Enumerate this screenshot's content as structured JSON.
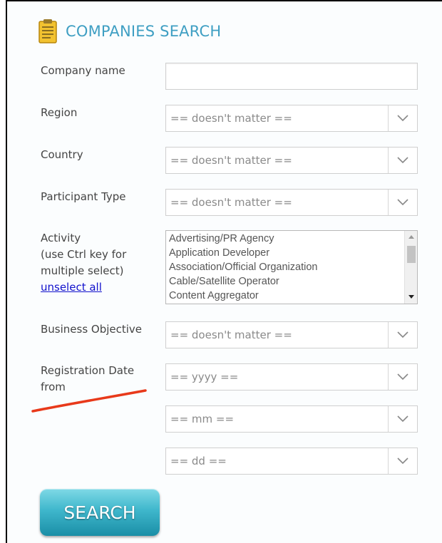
{
  "header": {
    "title": "COMPANIES SEARCH",
    "icon": "clipboard-icon"
  },
  "form": {
    "company_name": {
      "label": "Company name",
      "value": "",
      "placeholder": ""
    },
    "region": {
      "label": "Region",
      "selected": "== doesn't matter =="
    },
    "country": {
      "label": "Country",
      "selected": "== doesn't matter =="
    },
    "participant_type": {
      "label": "Participant Type",
      "selected": "== doesn't matter =="
    },
    "activity": {
      "label_line1": "Activity",
      "label_line2": "(use Ctrl key for",
      "label_line3": "multiple select)",
      "unselect_label": "unselect all",
      "options": [
        "Advertising/PR Agency",
        "Application Developer",
        "Association/Official Organization",
        "Cable/Satellite Operator",
        "Content Aggregator"
      ]
    },
    "business_objective": {
      "label": "Business Objective",
      "selected": "== doesn't matter =="
    },
    "registration_date": {
      "label_line1": "Registration Date",
      "label_line2": "from",
      "year": "== yyyy ==",
      "month": "== mm ==",
      "day": "== dd =="
    }
  },
  "search_button": {
    "label": "SEARCH"
  },
  "colors": {
    "title": "#3f9fc3",
    "annotation": "#e8391a",
    "button": "#3fb7cc"
  }
}
